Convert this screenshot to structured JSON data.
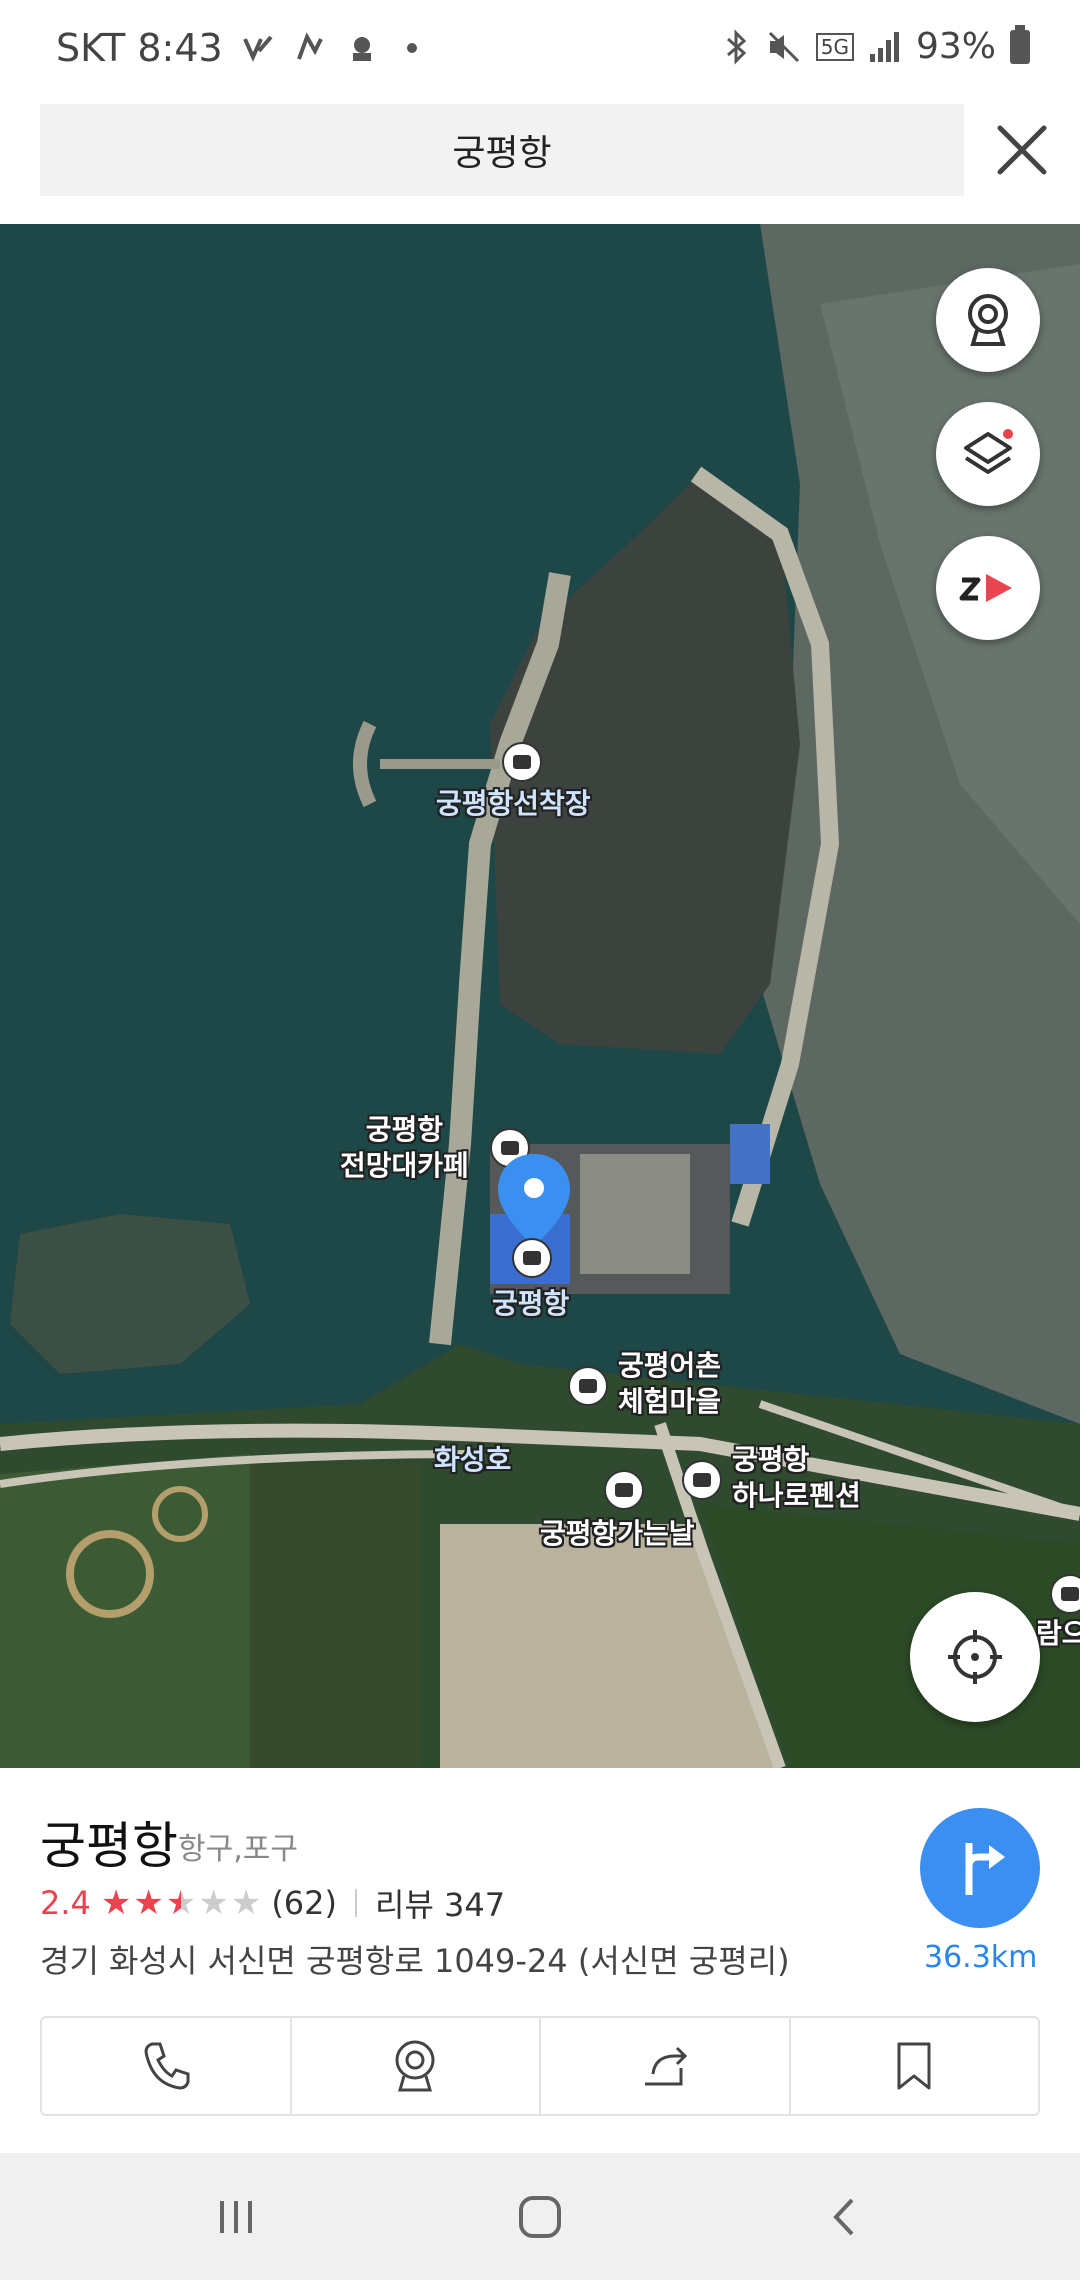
{
  "status_bar": {
    "carrier_time": "SKT 8:43",
    "network": "5G",
    "battery": "93%"
  },
  "search": {
    "query": "궁평항"
  },
  "map": {
    "labels": {
      "pier": "궁평항선착장",
      "cafe_line1": "궁평항",
      "cafe_line2": "전망대카페",
      "port": "궁평항",
      "village_line1": "궁평어촌",
      "village_line2": "체험마을",
      "lake": "화성호",
      "pension_line1": "궁평항",
      "pension_line2": "하나로펜션",
      "going_day": "궁평항가는날",
      "partial": "람으"
    }
  },
  "place": {
    "name": "궁평항",
    "category": "항구,포구",
    "rating": "2.4",
    "rating_fraction": 0.48,
    "rating_count": "(62)",
    "review_label": "리뷰 347",
    "address": "경기 화성시 서신면 궁평항로 1049-24 (서신면 궁평리)",
    "distance": "36.3km"
  },
  "colors": {
    "accent_blue": "#3b8ff1",
    "rating_red": "#e8434e",
    "water": "#1e4747"
  }
}
